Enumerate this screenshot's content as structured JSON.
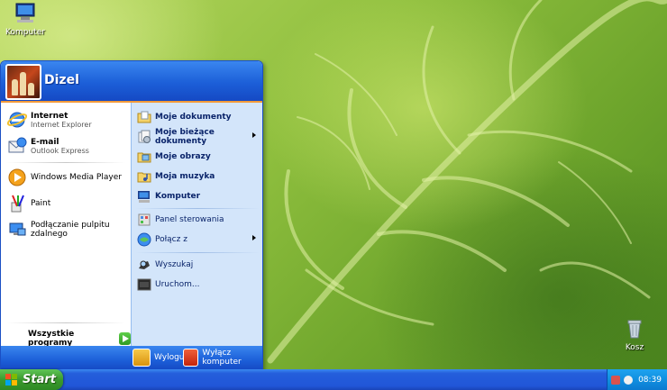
{
  "desktop": {
    "icons": [
      {
        "label": "Komputer"
      },
      {
        "label": "Kosz"
      }
    ]
  },
  "user": {
    "name": "Dizel"
  },
  "left_pinned": [
    {
      "title": "Internet",
      "subtitle": "Internet Explorer"
    },
    {
      "title": "E-mail",
      "subtitle": "Outlook Express"
    }
  ],
  "left_recent": [
    {
      "title": "Windows Media Player"
    },
    {
      "title": "Paint"
    },
    {
      "title": "Podłączanie pulpitu zdalnego"
    }
  ],
  "all_programs_label": "Wszystkie programy",
  "right_items": [
    {
      "label": "Moje dokumenty",
      "icon": "folder-documents-icon"
    },
    {
      "label": "Moje bieżące dokumenty",
      "icon": "recent-documents-icon"
    },
    {
      "label": "Moje obrazy",
      "icon": "folder-pictures-icon"
    },
    {
      "label": "Moja muzyka",
      "icon": "folder-music-icon"
    },
    {
      "label": "Komputer",
      "icon": "computer-icon"
    },
    {
      "label": "Panel sterowania",
      "icon": "control-panel-icon"
    },
    {
      "label": "Połącz z",
      "icon": "connect-icon"
    },
    {
      "label": "Wyszukaj",
      "icon": "search-icon"
    },
    {
      "label": "Uruchom...",
      "icon": "run-icon"
    }
  ],
  "footer": {
    "logoff_label": "Wyloguj",
    "shutdown_label": "Wyłącz komputer"
  },
  "taskbar": {
    "start_label": "Start",
    "clock": "08:39"
  },
  "colors": {
    "header_blue": "#1c5fd8",
    "right_panel": "#d3e5fa",
    "start_green": "#3a9a2e",
    "tray_blue": "#118fe0"
  }
}
